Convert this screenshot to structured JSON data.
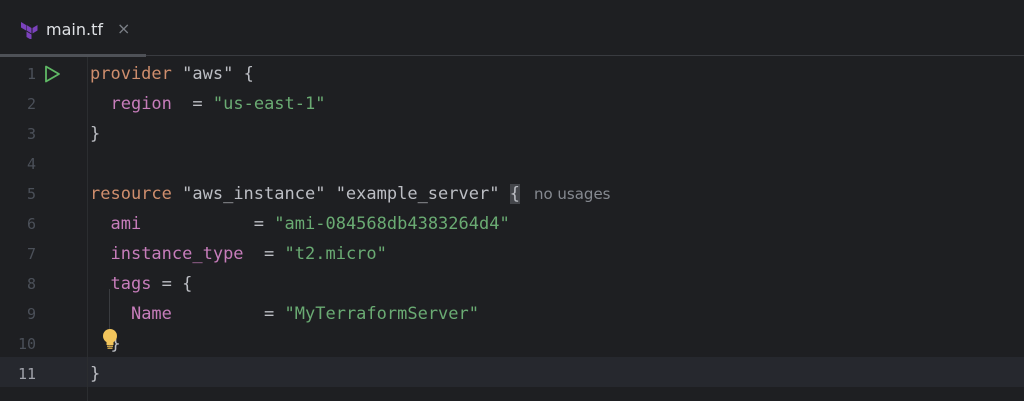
{
  "tab": {
    "file_name": "main.tf",
    "close_glyph": "×",
    "icon": "terraform-icon"
  },
  "editor": {
    "current_line": 11,
    "line_numbers": [
      "1",
      "2",
      "3",
      "4",
      "5",
      "6",
      "7",
      "8",
      "9",
      "10",
      "11"
    ],
    "lines": {
      "l1": {
        "keyword": "provider",
        "name": "\"aws\"",
        "brace": "{"
      },
      "l2": {
        "key": "region",
        "eq": "=",
        "value": "\"us-east-1\""
      },
      "l3": {
        "brace": "}"
      },
      "l5": {
        "keyword": "resource",
        "type": "\"aws_instance\"",
        "name": "\"example_server\"",
        "brace": "{",
        "hint": "no usages"
      },
      "l6": {
        "key": "ami",
        "eq": "=",
        "value": "\"ami-084568db4383264d4\""
      },
      "l7": {
        "key": "instance_type",
        "eq": "=",
        "value": "\"t2.micro\""
      },
      "l8": {
        "key": "tags",
        "rest": " = {"
      },
      "l9": {
        "key": "Name",
        "eq": "=",
        "value": "\"MyTerraformServer\""
      },
      "l10": {
        "brace": "}"
      },
      "l11": {
        "brace": "}"
      }
    }
  },
  "icons": {
    "run": "run-icon",
    "bulb": "lightbulb-icon"
  },
  "colors": {
    "background": "#1e1f22",
    "keyword": "#cf8e6d",
    "string": "#6aab73",
    "property": "#c77dbb",
    "text": "#bcbec4",
    "terraform": "#7b42bc",
    "run": "#5fb865",
    "bulb": "#f2c55c"
  }
}
